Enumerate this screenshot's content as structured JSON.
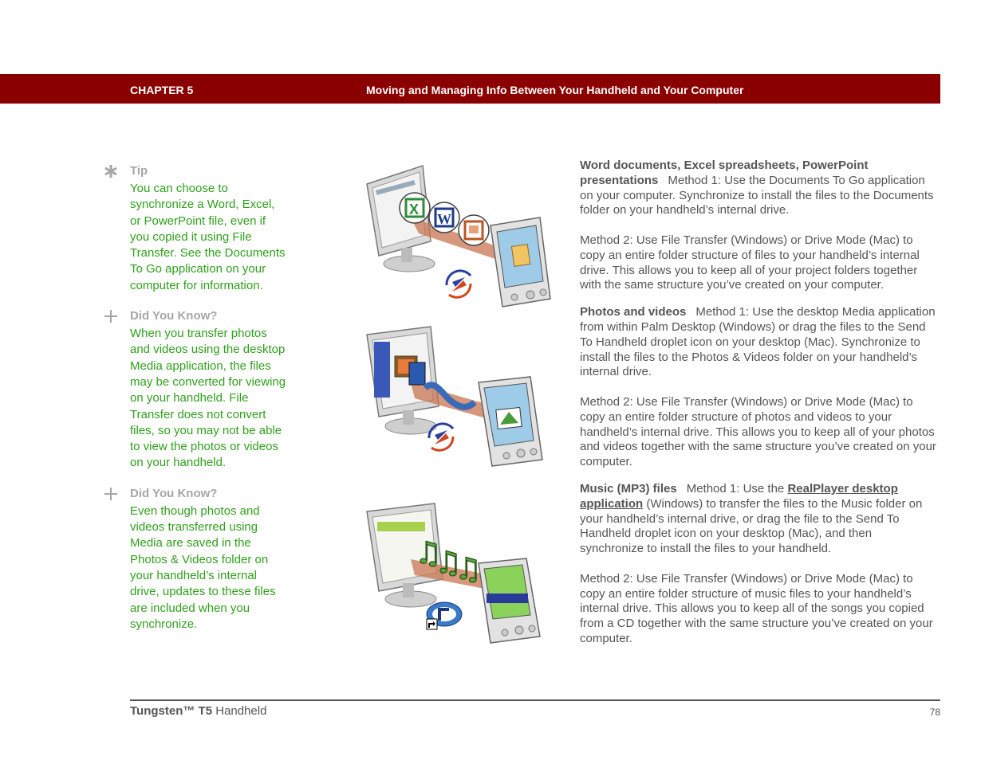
{
  "header": {
    "chapter": "CHAPTER 5",
    "title": "Moving and Managing Info Between Your Handheld and Your Computer",
    "bar_color": "#8a0000"
  },
  "sidebar": {
    "notes": [
      {
        "icon": "asterisk-icon",
        "title": "Tip",
        "body": "You can choose to synchronize a Word, Excel, or PowerPoint file, even if you copied it using File Transfer. See the Documents To Go application on your computer for information."
      },
      {
        "icon": "plus-icon",
        "title": "Did You Know?",
        "body": "When you transfer photos and videos using the desktop Media application, the files may be converted for viewing on your handheld. File Transfer does not convert files, so you may not be able to view the photos or videos on your handheld."
      },
      {
        "icon": "plus-icon",
        "title": "Did You Know?",
        "body": "Even though photos and videos transferred using Media are saved in the Photos & Videos folder on your handheld’s internal drive, updates to these files are included when you synchronize."
      }
    ],
    "text_color": "#2fa01b",
    "title_color": "#a6a6a6"
  },
  "illustrations": [
    {
      "name": "documents-transfer",
      "items": [
        "excel-icon",
        "word-icon",
        "powerpoint-icon",
        "sync-icon",
        "handheld",
        "monitor"
      ]
    },
    {
      "name": "photos-videos-transfer",
      "items": [
        "photo-icon",
        "film-icon",
        "sync-icon",
        "handheld",
        "monitor"
      ]
    },
    {
      "name": "music-transfer",
      "items": [
        "music-note-icon",
        "realplayer-icon",
        "shortcut-arrow-icon",
        "handheld",
        "monitor"
      ]
    }
  ],
  "content": {
    "sections": [
      {
        "title": "Word documents, Excel spreadsheets, PowerPoint presentations",
        "method1": "Method 1: Use the Documents To Go application on your computer. Synchronize to install the files to the Documents folder on your handheld’s internal drive.",
        "method2": "Method 2: Use File Transfer (Windows) or Drive Mode (Mac) to copy an entire folder structure of files to your handheld’s internal drive. This allows you to keep all of your project folders together with the same structure you’ve created on your computer."
      },
      {
        "title": "Photos and videos",
        "method1": "Method 1: Use the desktop Media application from within Palm Desktop (Windows) or drag the files to the Send To Handheld droplet icon on your desktop (Mac). Synchronize to install the files to the Photos & Videos folder on your handheld’s internal drive.",
        "method2": "Method 2: Use File Transfer (Windows) or Drive Mode (Mac) to copy an entire folder structure of photos and videos to your handheld’s internal drive. This allows you to keep all of your photos and videos together with the same structure you’ve created on your computer."
      },
      {
        "title": "Music (MP3) files",
        "method1_prefix": "Method 1: Use the ",
        "method1_link": "RealPlayer desktop application",
        "method1_suffix": " (Windows) to transfer the files to the Music folder on your handheld’s internal drive, or drag the file to the Send To Handheld droplet icon on your desktop (Mac), and then synchronize to install the files to your handheld.",
        "method2": "Method 2: Use File Transfer (Windows) or Drive Mode (Mac) to copy an entire folder structure of music files to your handheld’s internal drive. This allows you to keep all of the songs you copied from a CD together with the same structure you’ve created on your computer."
      }
    ]
  },
  "footer": {
    "product_bold": "Tungsten™ T5",
    "product_rest": " Handheld",
    "page_number": "78"
  }
}
